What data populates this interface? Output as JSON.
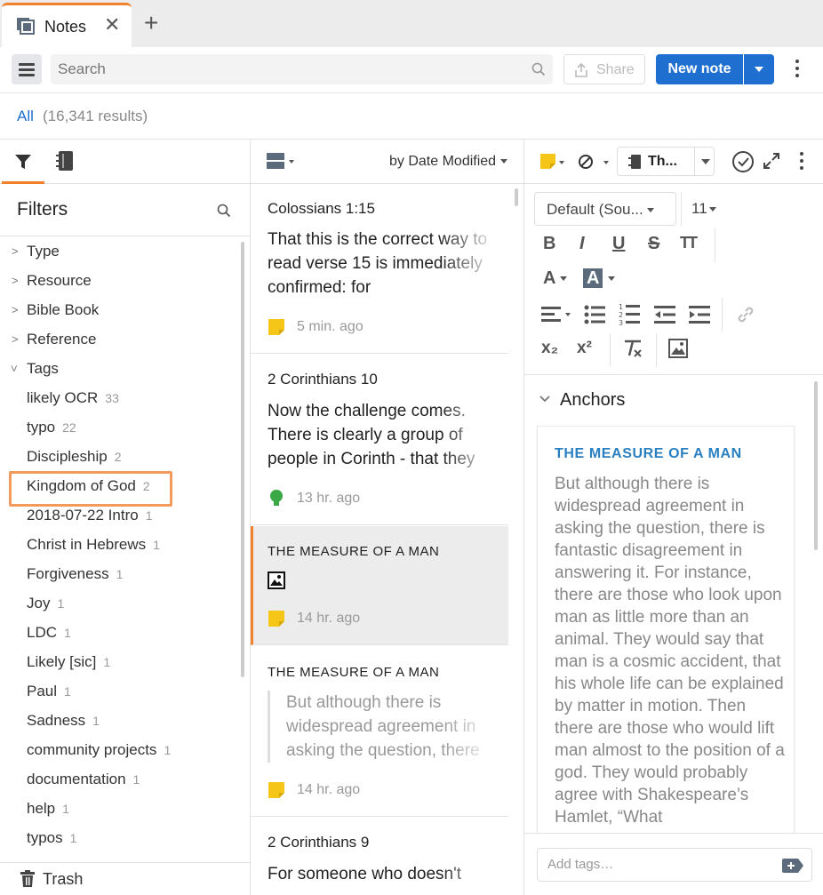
{
  "tab": {
    "label": "Notes",
    "close": "✕",
    "add": "+"
  },
  "toolbar": {
    "search_placeholder": "Search",
    "share_label": "Share",
    "new_note_label": "New note"
  },
  "results": {
    "all": "All",
    "count": "(16,341 results)"
  },
  "filters": {
    "title": "Filters",
    "categories": [
      "Type",
      "Resource",
      "Bible Book",
      "Reference",
      "Tags"
    ],
    "tags": [
      {
        "name": "likely OCR",
        "count": "33"
      },
      {
        "name": "typo",
        "count": "22"
      },
      {
        "name": "Discipleship",
        "count": "2"
      },
      {
        "name": "Kingdom of God",
        "count": "2"
      },
      {
        "name": "2018-07-22 Intro",
        "count": "1"
      },
      {
        "name": "Christ in Hebrews",
        "count": "1"
      },
      {
        "name": "Forgiveness",
        "count": "1"
      },
      {
        "name": "Joy",
        "count": "1"
      },
      {
        "name": "LDC",
        "count": "1"
      },
      {
        "name": "Likely [sic]",
        "count": "1"
      },
      {
        "name": "Paul",
        "count": "1"
      },
      {
        "name": "Sadness",
        "count": "1"
      },
      {
        "name": "community projects",
        "count": "1"
      },
      {
        "name": "documentation",
        "count": "1"
      },
      {
        "name": "help",
        "count": "1"
      },
      {
        "name": "typos",
        "count": "1"
      }
    ],
    "trash_label": "Trash"
  },
  "notes": {
    "sort_label": "by Date Modified",
    "items": [
      {
        "title": "Colossians 1:15",
        "body": "That this is the correct way to read verse 15 is immediately confirmed: for",
        "time": "5 min. ago"
      },
      {
        "title": "2 Corinthians 10",
        "body": "Now the challenge comes. There is clearly a group of people in Corinth - that they",
        "time": "13 hr. ago"
      },
      {
        "title": "THE MEASURE OF A MAN",
        "body": "",
        "time": "14 hr. ago"
      },
      {
        "title": "THE MEASURE OF A MAN",
        "body": "But although there is widespread agreement in asking the question, there",
        "time": "14 hr. ago"
      },
      {
        "title": "2 Corinthians 9",
        "body": "For someone who doesn't"
      }
    ]
  },
  "editor": {
    "notebook_label": "Th...",
    "font_label": "Default (Sou...",
    "size_label": "11",
    "buttons": {
      "bold": "B",
      "italic": "I",
      "underline": "U",
      "strike": "S",
      "case": "TT",
      "font_color": "A",
      "highlight": "A",
      "subscript": "x₂",
      "superscript": "x²"
    },
    "anchors_label": "Anchors",
    "anchor_title": "THE MEASURE OF A MAN",
    "anchor_text": "But although there is widespread agreement in asking the question, there is fantastic disagreement in answering it. For instance, there are those who look upon man as little more than an animal. They would say that man is a cosmic accident, that his whole life can be explained by matter in motion. Then there are those who would lift man almost to the position of a god. They would probably agree with Shakespeare’s Hamlet, “What",
    "tags_placeholder": "Add tags…"
  }
}
